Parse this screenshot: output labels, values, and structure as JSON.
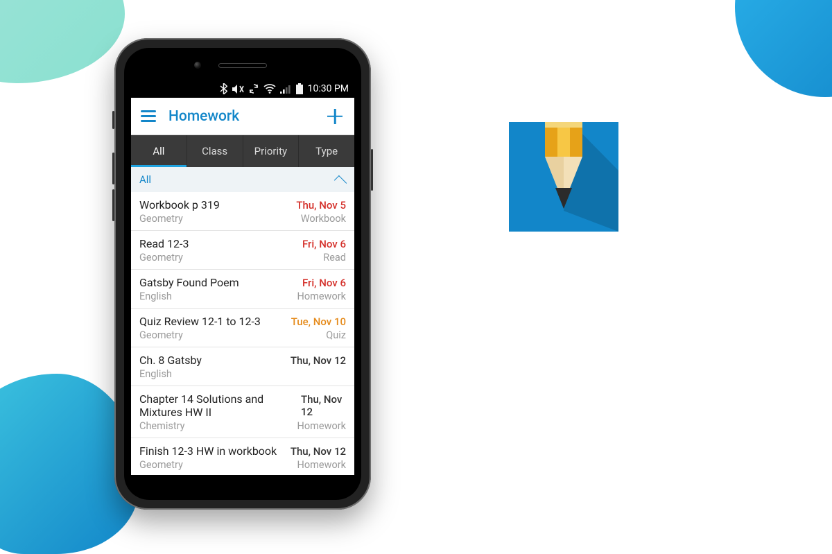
{
  "statusbar": {
    "time": "10:30 PM"
  },
  "appbar": {
    "title": "Homework",
    "menu_icon": "menu-icon",
    "add_icon": "plus-icon"
  },
  "tabs": [
    {
      "label": "All",
      "active": true
    },
    {
      "label": "Class",
      "active": false
    },
    {
      "label": "Priority",
      "active": false
    },
    {
      "label": "Type",
      "active": false
    }
  ],
  "group_label": "All",
  "items": [
    {
      "title": "Workbook p 319",
      "subject": "Geometry",
      "date": "Thu, Nov 5",
      "date_color": "red",
      "type": "Workbook"
    },
    {
      "title": "Read 12-3",
      "subject": "Geometry",
      "date": "Fri, Nov 6",
      "date_color": "red",
      "type": "Read"
    },
    {
      "title": "Gatsby Found Poem",
      "subject": "English",
      "date": "Fri, Nov 6",
      "date_color": "red",
      "type": "Homework"
    },
    {
      "title": "Quiz Review 12-1 to 12-3",
      "subject": "Geometry",
      "date": "Tue, Nov 10",
      "date_color": "orange",
      "type": "Quiz"
    },
    {
      "title": "Ch. 8 Gatsby",
      "subject": "English",
      "date": "Thu, Nov 12",
      "date_color": "black",
      "type": ""
    },
    {
      "title": "Chapter 14 Solutions and Mixtures HW II",
      "subject": "Chemistry",
      "date": "Thu, Nov 12",
      "date_color": "black",
      "type": "Homework"
    },
    {
      "title": "Finish 12-3 HW in workbook",
      "subject": "Geometry",
      "date": "Thu, Nov 12",
      "date_color": "black",
      "type": "Homework"
    }
  ],
  "colors": {
    "accent": "#1286c9",
    "tab_bg": "#3a3a3a",
    "date_red": "#d4302a",
    "date_orange": "#e58a1a"
  }
}
